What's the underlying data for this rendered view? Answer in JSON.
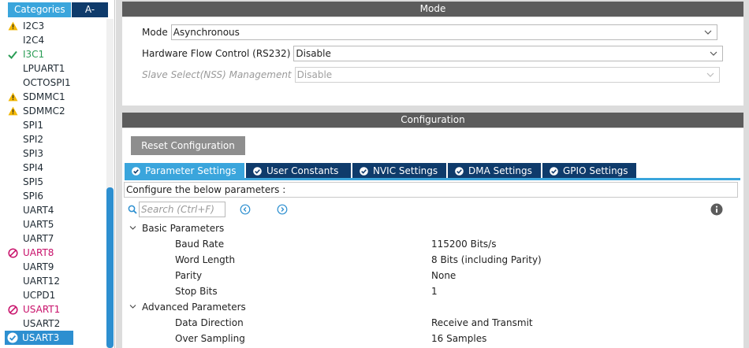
{
  "categories_tabs": [
    {
      "label": "Categories",
      "active": true
    },
    {
      "label": "A->Z",
      "active": false
    }
  ],
  "peripherals": [
    {
      "label": "I2C3",
      "status": "warning"
    },
    {
      "label": "I2C4",
      "status": "none"
    },
    {
      "label": "I3C1",
      "status": "ok"
    },
    {
      "label": "LPUART1",
      "status": "none"
    },
    {
      "label": "OCTOSPI1",
      "status": "none"
    },
    {
      "label": "SDMMC1",
      "status": "warning"
    },
    {
      "label": "SDMMC2",
      "status": "warning"
    },
    {
      "label": "SPI1",
      "status": "none"
    },
    {
      "label": "SPI2",
      "status": "none"
    },
    {
      "label": "SPI3",
      "status": "none"
    },
    {
      "label": "SPI4",
      "status": "none"
    },
    {
      "label": "SPI5",
      "status": "none"
    },
    {
      "label": "SPI6",
      "status": "none"
    },
    {
      "label": "UART4",
      "status": "none"
    },
    {
      "label": "UART5",
      "status": "none"
    },
    {
      "label": "UART7",
      "status": "none"
    },
    {
      "label": "UART8",
      "status": "error"
    },
    {
      "label": "UART9",
      "status": "none"
    },
    {
      "label": "UART12",
      "status": "none"
    },
    {
      "label": "UCPD1",
      "status": "none"
    },
    {
      "label": "USART1",
      "status": "error"
    },
    {
      "label": "USART2",
      "status": "none"
    },
    {
      "label": "USART3",
      "status": "selected"
    }
  ],
  "mode": {
    "header": "Mode",
    "rows": [
      {
        "label": "Mode",
        "value": "Asynchronous",
        "disabled": false
      },
      {
        "label": "Hardware Flow Control (RS232)",
        "value": "Disable",
        "disabled": false
      },
      {
        "label": "Slave Select(NSS) Management",
        "value": "Disable",
        "disabled": true
      }
    ]
  },
  "configuration": {
    "header": "Configuration",
    "reset_label": "Reset Configuration",
    "tabs": [
      {
        "label": "Parameter Settings",
        "active": true
      },
      {
        "label": "User Constants",
        "active": false
      },
      {
        "label": "NVIC Settings",
        "active": false
      },
      {
        "label": "DMA Settings",
        "active": false
      },
      {
        "label": "GPIO Settings",
        "active": false
      }
    ],
    "configure_text": "Configure the below parameters :",
    "search_placeholder": "Search (Ctrl+F)",
    "groups": [
      {
        "label": "Basic Parameters",
        "params": [
          {
            "name": "Baud Rate",
            "value": "115200 Bits/s"
          },
          {
            "name": "Word Length",
            "value": "8 Bits (including Parity)"
          },
          {
            "name": "Parity",
            "value": "None"
          },
          {
            "name": "Stop Bits",
            "value": "1"
          }
        ]
      },
      {
        "label": "Advanced Parameters",
        "params": [
          {
            "name": "Data Direction",
            "value": "Receive and Transmit"
          },
          {
            "name": "Over Sampling",
            "value": "16 Samples"
          }
        ]
      }
    ]
  },
  "colors": {
    "accent": "#3aa5dc",
    "dark_tab": "#0f3b6b",
    "section_header": "#5c5c5c",
    "selected": "#2d8fd0",
    "warning": "#f2b705",
    "ok": "#2a9c55",
    "error": "#c8106a"
  }
}
